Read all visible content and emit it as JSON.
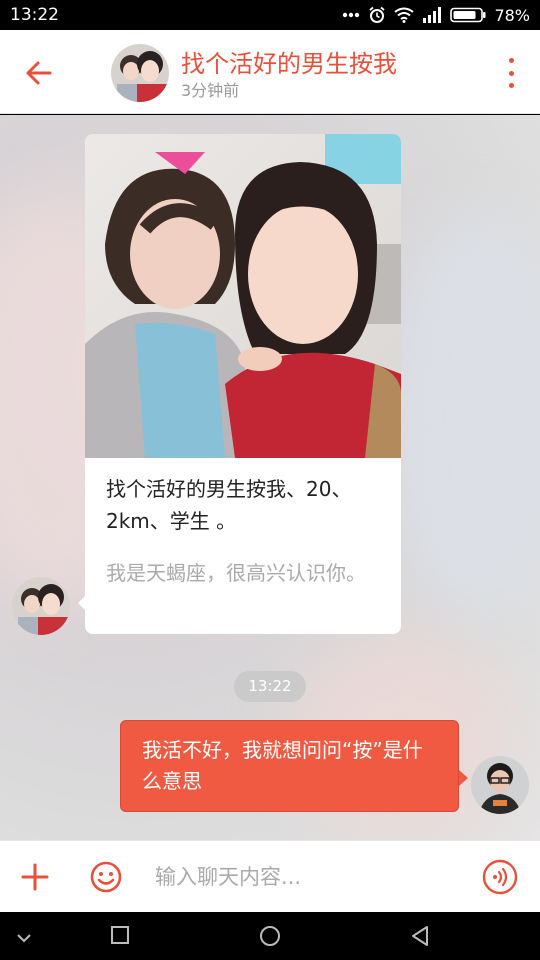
{
  "status_bar": {
    "time": "13:22",
    "battery": "78%",
    "icons": [
      "more-dots-icon",
      "alarm-icon",
      "wifi-icon",
      "signal-icon",
      "battery-icon"
    ]
  },
  "header": {
    "title": "找个活好的男生按我",
    "subtitle": "3分钟前",
    "icons": [
      "back-arrow-icon",
      "more-vert-icon"
    ]
  },
  "messages": [
    {
      "type": "card",
      "side": "left",
      "title": "找个活好的男生按我、20、2km、学生 。",
      "description": "我是天蝎座，很高兴认识你。"
    },
    {
      "type": "time",
      "text": "13:22"
    },
    {
      "type": "text",
      "side": "right",
      "text": "我活不好，我就想问问“按”是什么意思"
    }
  ],
  "input_bar": {
    "placeholder": "输入聊天内容...",
    "value": "",
    "icons": [
      "plus-icon",
      "emoji-icon",
      "voice-icon"
    ]
  },
  "nav_bar": {
    "icons": [
      "collapse-icon",
      "recents-icon",
      "home-icon",
      "back-icon"
    ]
  },
  "colors": {
    "accent": "#e8503a",
    "bubble": "#f05a42"
  }
}
